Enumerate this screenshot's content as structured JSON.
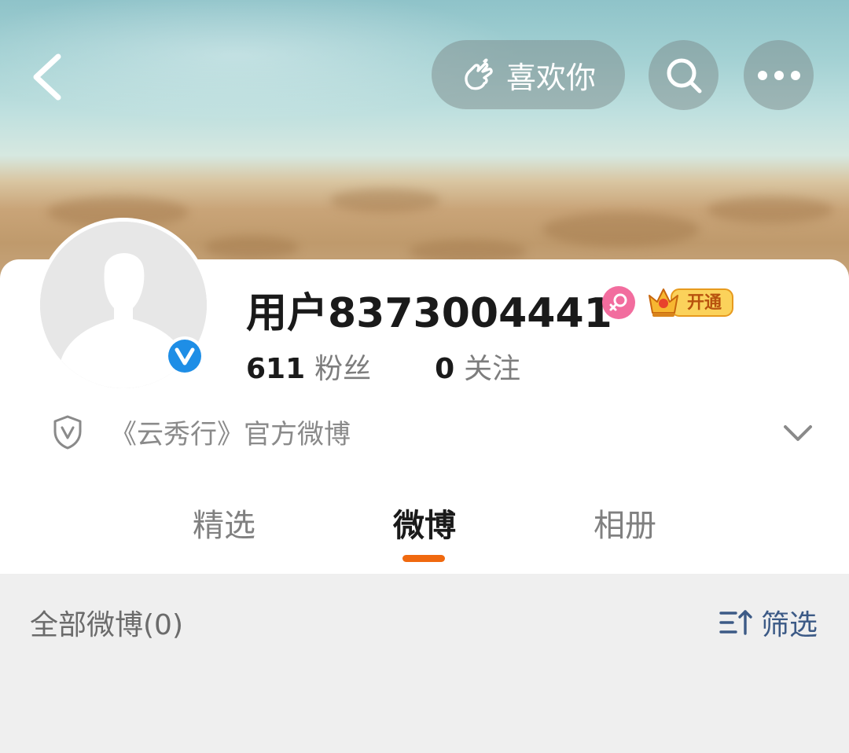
{
  "header": {
    "back_icon": "chevron-left-icon",
    "like_label": "喜欢你",
    "like_icon": "finger-heart-icon",
    "search_icon": "search-icon",
    "more_icon": "more-dots-icon"
  },
  "profile": {
    "username": "用户8373004441",
    "gender_icon": "female-icon",
    "verified_icon": "verified-v-icon",
    "vip_label": "开通",
    "followers_count": "611",
    "followers_label": "粉丝",
    "following_count": "0",
    "following_label": "关注",
    "bio": "《云秀行》官方微博",
    "bio_icon": "shield-v-icon",
    "expand_icon": "chevron-down-icon"
  },
  "tabs": [
    {
      "label": "精选",
      "active": false
    },
    {
      "label": "微博",
      "active": true
    },
    {
      "label": "相册",
      "active": false
    }
  ],
  "feed": {
    "title": "全部微博(0)",
    "filter_label": "筛选",
    "filter_icon": "filter-sort-icon"
  },
  "colors": {
    "accent": "#f0690f",
    "filter_blue": "#3c5a86",
    "verified_blue": "#1e8ee6",
    "gender_pink": "#f26d9e"
  }
}
